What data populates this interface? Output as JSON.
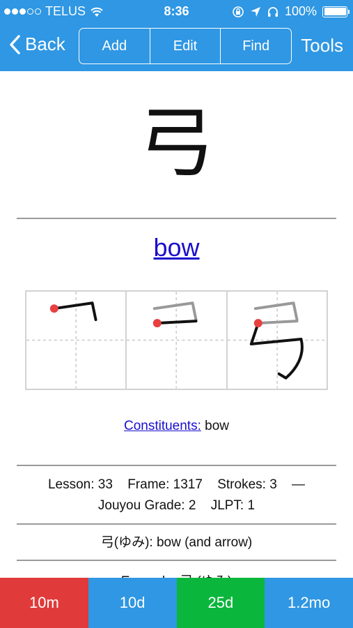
{
  "status_bar": {
    "signal_dots": [
      true,
      true,
      true,
      false,
      false
    ],
    "carrier": "TELUS",
    "wifi_icon": "wifi-icon",
    "time": "8:36",
    "battery_percent": "100%",
    "battery_level": 1.0
  },
  "nav": {
    "back_label": "Back",
    "segments": [
      "Add",
      "Edit",
      "Find"
    ],
    "tools_label": "Tools"
  },
  "card": {
    "kanji": "弓",
    "keyword": "bow",
    "constituents_label": "Constituents:",
    "constituents_value": "bow",
    "lesson": "Lesson: 33",
    "frame": "Frame: 1317",
    "strokes": "Strokes: 3",
    "dash": "—",
    "jouyou": "Jouyou Grade: 2",
    "jlpt": "JLPT: 1",
    "reading": "弓(ゆみ): bow (and arrow)",
    "example_peek": "Example: 弓 (ゆみ)"
  },
  "review_buttons": [
    {
      "label": "10m",
      "color": "#e03a3a"
    },
    {
      "label": "10d",
      "color": "#2f97e3"
    },
    {
      "label": "25d",
      "color": "#0ab63b"
    },
    {
      "label": "1.2mo",
      "color": "#2f97e3"
    }
  ],
  "colors": {
    "bar_blue": "#2f97e3",
    "link_blue": "#1a0dcc",
    "stroke_start_red": "#e84040"
  }
}
